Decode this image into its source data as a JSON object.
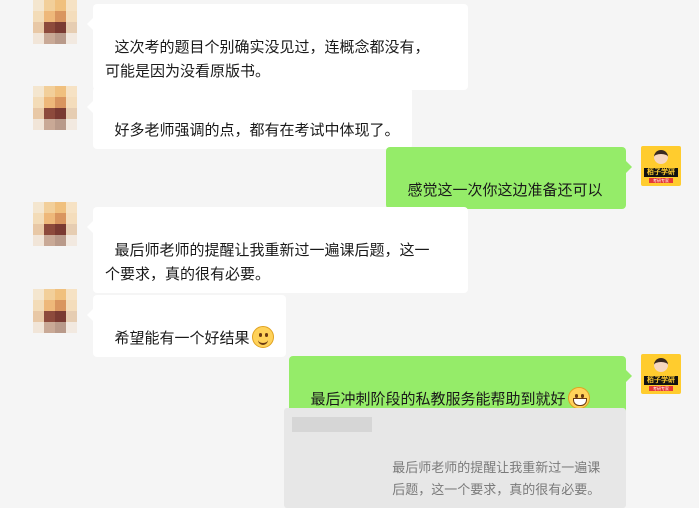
{
  "messages": [
    {
      "side": "left",
      "text": "这次考的题目个别确实没见过，连概念都没有，\n可能是因为没看原版书。"
    },
    {
      "side": "left",
      "text": "好多老师强调的点，都有在考试中体现了。"
    },
    {
      "side": "right",
      "text": "感觉这一次你这边准备还可以"
    },
    {
      "side": "left",
      "text": "最后师老师的提醒让我重新过一遍课后题，这一\n个要求，真的很有必要。"
    },
    {
      "side": "left",
      "text": "希望能有一个好结果",
      "emoji": "smile-emoji"
    },
    {
      "side": "right",
      "text": "最后冲刺阶段的私教服务能帮助到就好",
      "emoji": "grin-emoji"
    }
  ],
  "quote": {
    "text": "最后师老师的提醒让我重新过一遍课\n后题，这一个要求，真的很有必要。"
  },
  "brand_avatar": {
    "title": "栢子学研",
    "sub": "考研专家"
  },
  "colors": {
    "background": "#f5f5f5",
    "left_bubble": "#ffffff",
    "right_bubble": "#95ec69",
    "quote": "#e7e7e7"
  }
}
